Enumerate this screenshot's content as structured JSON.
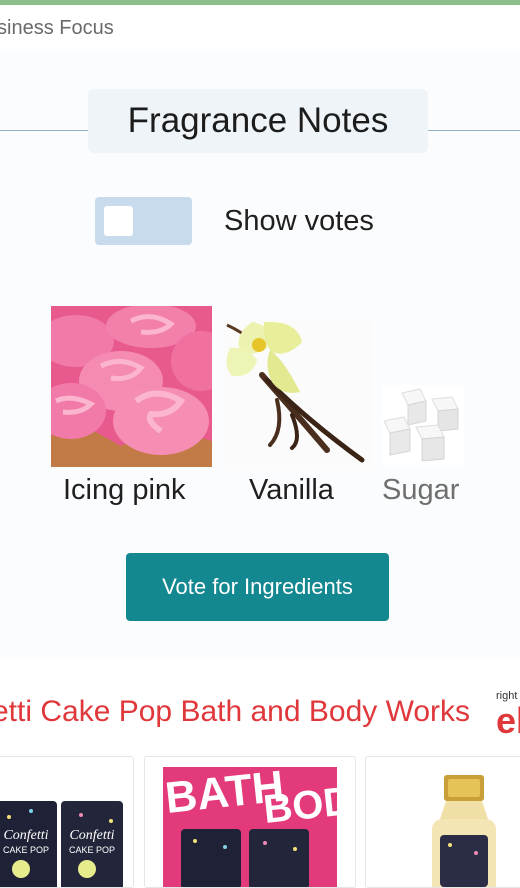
{
  "top_section": {
    "label": "siness Focus"
  },
  "fragrance": {
    "title": "Fragrance Notes",
    "toggle_label": "Show votes",
    "ingredients": [
      {
        "name": "Icing pink"
      },
      {
        "name": "Vanilla"
      },
      {
        "name": "Sugar"
      }
    ],
    "vote_button": "Vote for Ingredients"
  },
  "products": {
    "heading": "etti Cake Pop Bath and Body Works",
    "badge_small": "right",
    "badge_logo": "el",
    "card_texts": [
      "Confetti",
      "CAKE POP",
      "BATH",
      "BODY"
    ]
  },
  "colors": {
    "accent_teal": "#138890",
    "heading_red": "#e0373b",
    "toggle_off": "#c8dbec"
  }
}
